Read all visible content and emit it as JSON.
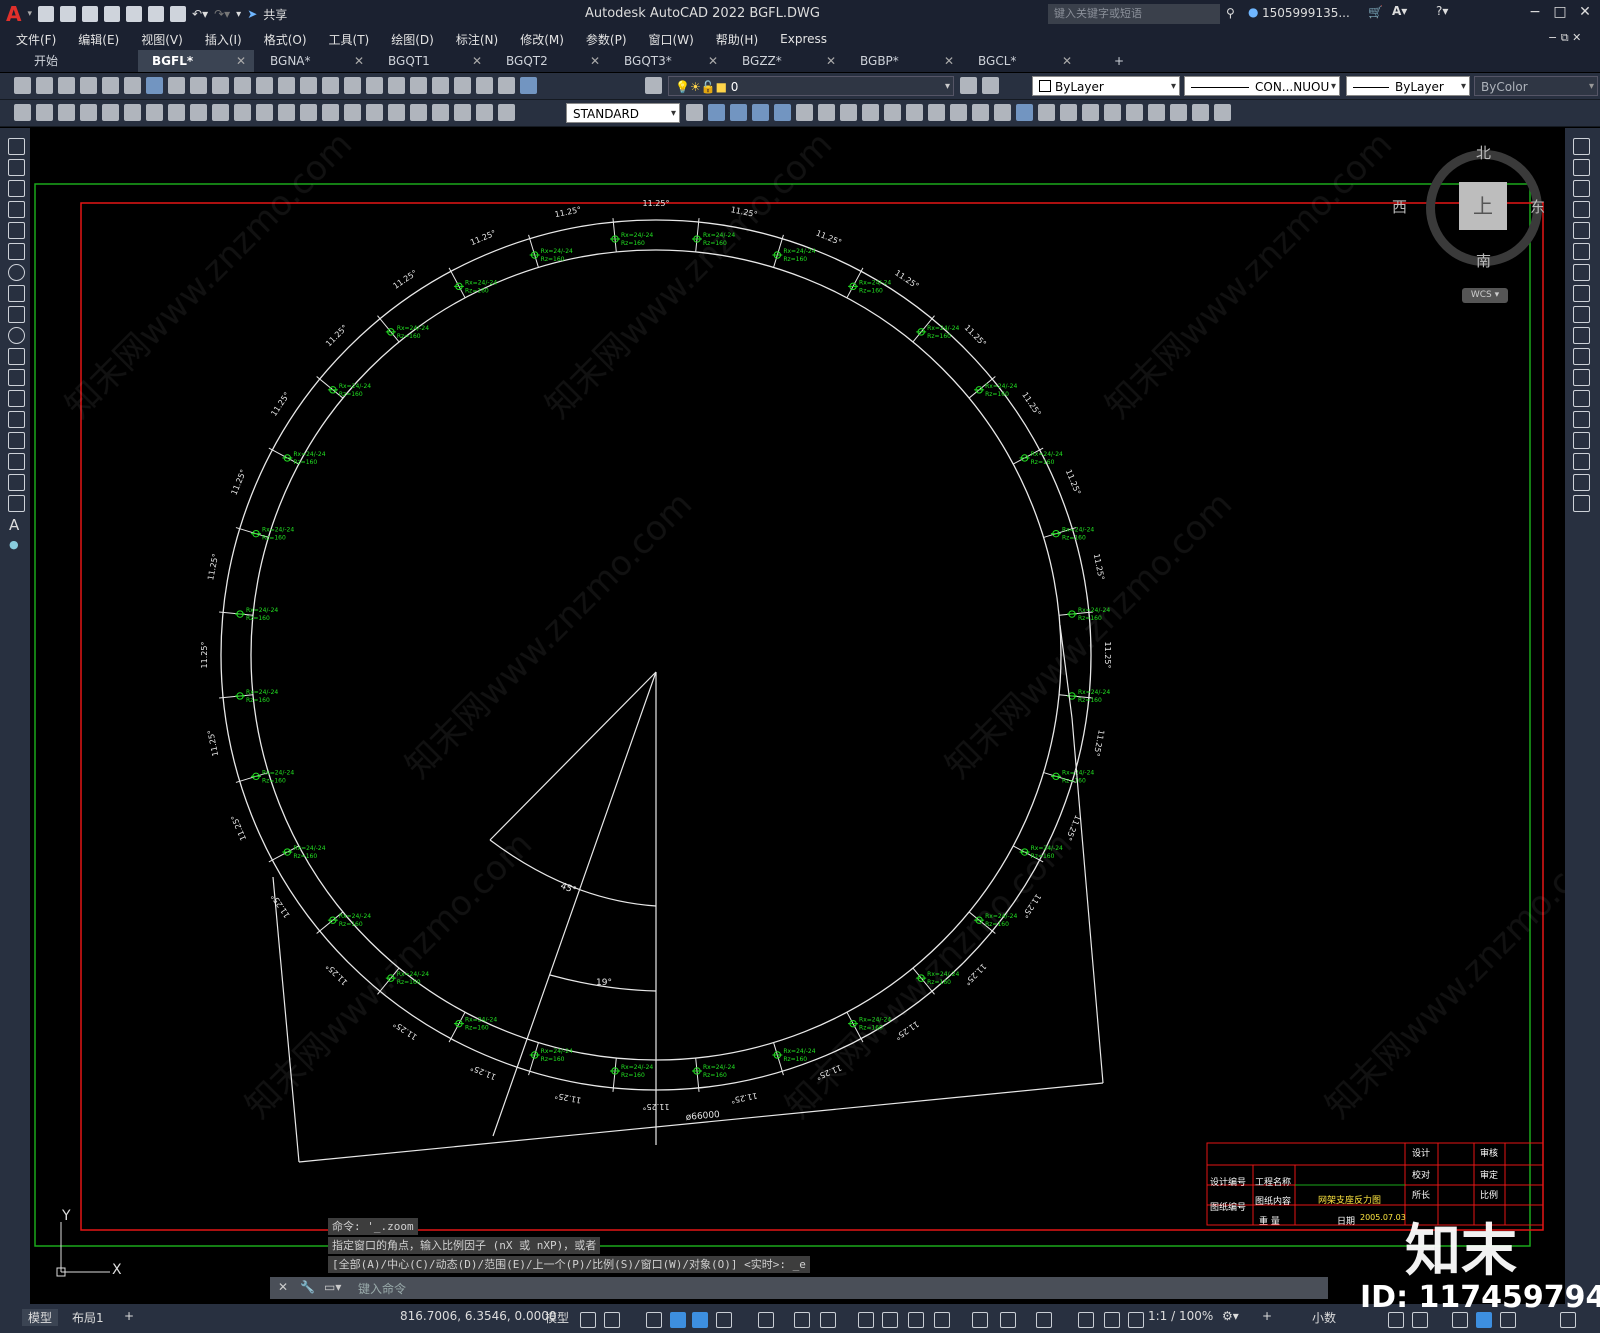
{
  "titlebar": {
    "app_title": "Autodesk AutoCAD 2022    BGFL.DWG",
    "share_label": "共享",
    "search_placeholder": "键入关键字或短语",
    "user_name": "1505999135..."
  },
  "menu": [
    "文件(F)",
    "编辑(E)",
    "视图(V)",
    "插入(I)",
    "格式(O)",
    "工具(T)",
    "绘图(D)",
    "标注(N)",
    "修改(M)",
    "参数(P)",
    "窗口(W)",
    "帮助(H)",
    "Express"
  ],
  "tabs": [
    {
      "label": "开始"
    },
    {
      "label": "BGFL*"
    },
    {
      "label": "BGNA*"
    },
    {
      "label": "BGQT1"
    },
    {
      "label": "BGQT2"
    },
    {
      "label": "BGQT3*"
    },
    {
      "label": "BGZZ*"
    },
    {
      "label": "BGBP*"
    },
    {
      "label": "BGCL*"
    }
  ],
  "properties": {
    "layer": "0",
    "color": "ByLayer",
    "linetype": "CON...NUOU",
    "lineweight": "ByLayer",
    "plotstyle": "ByColor",
    "textstyle": "STANDARD"
  },
  "viewcube": {
    "north": "北",
    "south": "南",
    "east": "东",
    "west": "西",
    "top": "上",
    "wcs": "WCS"
  },
  "drawing": {
    "segment_angle": "11.25°",
    "sector_angle_1": "45°",
    "sector_angle_2": "19°",
    "diameter": "ø66000",
    "support_label": "Rx=24/-24",
    "support_label_2": "Rz=160"
  },
  "title_block": {
    "design_no": "设计编号",
    "project_name": "工程名称",
    "drawing_content": "图纸内容",
    "drawing_no": "图纸编号",
    "weight": "重  量",
    "drawing_title": "网架支座反力图",
    "design": "设计",
    "check": "校对",
    "chief": "所长",
    "audit": "审核",
    "approve": "审定",
    "scale": "比例",
    "date_label": "日期",
    "date": "2005.07.03"
  },
  "command": {
    "line1": "命令: '_.zoom",
    "line2": "指定窗口的角点，输入比例因子 (nX 或 nXP)，或者",
    "line3": "[全部(A)/中心(C)/动态(D)/范围(E)/上一个(P)/比例(S)/窗口(W)/对象(O)] <实时>: _e",
    "placeholder": "键入命令"
  },
  "status": {
    "model_tab": "模型",
    "layout_tab": "布局1",
    "coords": "816.7006, 6.3546, 0.0000",
    "mode": "模型",
    "scale": "1:1 / 100%",
    "units": "小数"
  },
  "watermark": {
    "logo": "知末",
    "id": "ID: 1174597944",
    "url": "知末网www.znzmo.com"
  },
  "ucs": {
    "x": "X",
    "y": "Y"
  }
}
